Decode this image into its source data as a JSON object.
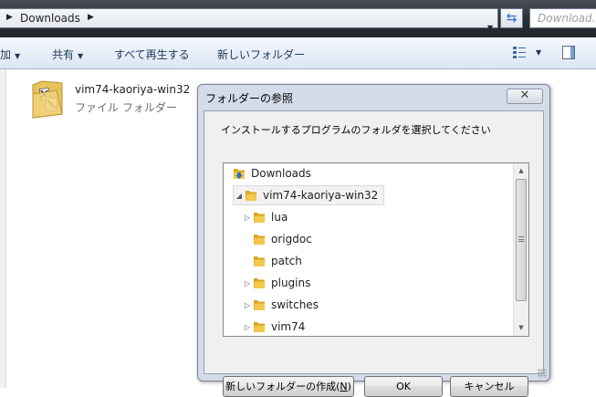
{
  "address_bar": {
    "path_segment": "Downloads",
    "search_placeholder": "Download..."
  },
  "toolbar": {
    "items": [
      {
        "label": "加",
        "has_dropdown": true
      },
      {
        "label": "共有",
        "has_dropdown": true
      },
      {
        "label": "すべて再生する",
        "has_dropdown": false
      },
      {
        "label": "新しいフォルダー",
        "has_dropdown": false
      }
    ]
  },
  "file_list": {
    "item_name": "vim74-kaoriya-win32",
    "item_type": "ファイル フォルダー"
  },
  "dialog": {
    "title": "フォルダーの参照",
    "close_symbol": "✕",
    "instruction": "インストールするプログラムのフォルダを選択してください",
    "tree": [
      {
        "label": "Downloads",
        "level": 0,
        "expander": "",
        "selected": false,
        "icon": "downloads-folder-icon"
      },
      {
        "label": "vim74-kaoriya-win32",
        "level": 1,
        "expander": "◢",
        "selected": true,
        "icon": "folder-icon"
      },
      {
        "label": "lua",
        "level": 2,
        "expander": "▷",
        "selected": false,
        "icon": "folder-icon"
      },
      {
        "label": "origdoc",
        "level": 2,
        "expander": "",
        "selected": false,
        "icon": "folder-icon"
      },
      {
        "label": "patch",
        "level": 2,
        "expander": "",
        "selected": false,
        "icon": "folder-icon"
      },
      {
        "label": "plugins",
        "level": 2,
        "expander": "▷",
        "selected": false,
        "icon": "folder-icon"
      },
      {
        "label": "switches",
        "level": 2,
        "expander": "▷",
        "selected": false,
        "icon": "folder-icon"
      },
      {
        "label": "vim74",
        "level": 2,
        "expander": "▷",
        "selected": false,
        "icon": "folder-icon"
      }
    ],
    "buttons": {
      "new_folder": "新しいフォルダーの作成(",
      "new_folder_key": "N",
      "new_folder_end": ")",
      "ok": "OK",
      "cancel": "キャンセル"
    }
  },
  "colors": {
    "folder_yellow": "#f2c94c",
    "folder_dark": "#d9a520",
    "toolbar_text": "#1e395b",
    "download_arrow": "#2a6fc3"
  }
}
